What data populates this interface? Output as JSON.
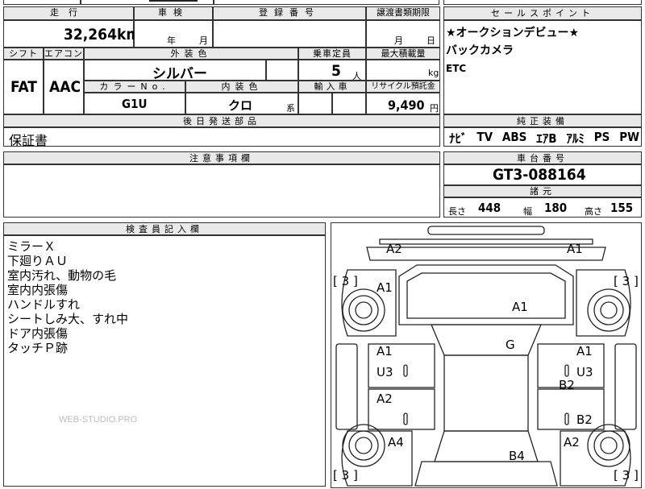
{
  "top_row": {
    "label_mileage": "走行",
    "label_inspection": "車検",
    "label_registration": "登録番号",
    "label_transfer": "譲渡書類期限",
    "mileage_value": "32,264",
    "mileage_unit": "km",
    "inspection_year": "年",
    "inspection_month": "月",
    "transfer_month": "月",
    "transfer_day": "日"
  },
  "spec_row": {
    "label_shift": "シフト",
    "label_aircon": "エアコン",
    "label_exterior": "外装色",
    "label_seats": "乗車定員",
    "label_load": "最大積載量",
    "shift": "FAT",
    "aircon": "AAC",
    "exterior_color": "シルバー",
    "seats": "5",
    "seats_unit": "人",
    "load_unit": "kg",
    "label_color_no": "カラーNo.",
    "label_interior": "内装色",
    "label_import": "輸入車",
    "label_recycle": "リサイクル預託金",
    "color_no": "G1U",
    "interior_color": "クロ",
    "interior_suffix": "系",
    "recycle_fee": "9,490",
    "recycle_unit": "円"
  },
  "sales_points": {
    "header": "セールスポイント",
    "lines": [
      "★オークションデビュー★",
      "バックカメラ",
      "ETC"
    ]
  },
  "later_parts": {
    "header": "後日発送部品",
    "value": "保証書"
  },
  "standard_equipment": {
    "header": "純正装備",
    "items": [
      "ﾅﾋﾞ",
      "TV",
      "ABS",
      "ｴｱB",
      "ｱﾙﾐ",
      "PS",
      "PW"
    ]
  },
  "notes": {
    "header": "注意事項欄"
  },
  "chassis": {
    "header": "車台番号",
    "number": "GT3-088164"
  },
  "dimensions": {
    "header": "諸元",
    "length_label": "長さ",
    "length": "448",
    "width_label": "幅",
    "width": "180",
    "height_label": "高さ",
    "height": "155"
  },
  "inspector": {
    "header": "検査員記入欄",
    "lines": [
      "ミラーＸ",
      "下廻りＡＵ",
      "室内汚れ、動物の毛",
      "室内内張傷",
      "ハンドルすれ",
      "シートしみ大、すれ中",
      "ドア内張傷",
      "タッチＰ跡"
    ],
    "watermark": "WEB-STUDIO.PRO"
  },
  "damage_map": {
    "codes": {
      "front_left_corner": "A2",
      "front_right_corner": "A1",
      "left_fender": "A1",
      "hood": "A1",
      "windshield": "G",
      "left_front_door_1": "A1",
      "left_front_door_2": "U3",
      "right_front_door_1": "A1",
      "right_front_door_2": "U3",
      "right_pillar": "B2",
      "left_rear_door": "A2",
      "right_rear_door": "B2",
      "left_rear_fender": "A4",
      "right_rear_fender": "A2",
      "trunk": "B4"
    },
    "tires": {
      "front_left": "3",
      "front_right": "3",
      "rear_left": "3",
      "rear_right": "3"
    }
  }
}
